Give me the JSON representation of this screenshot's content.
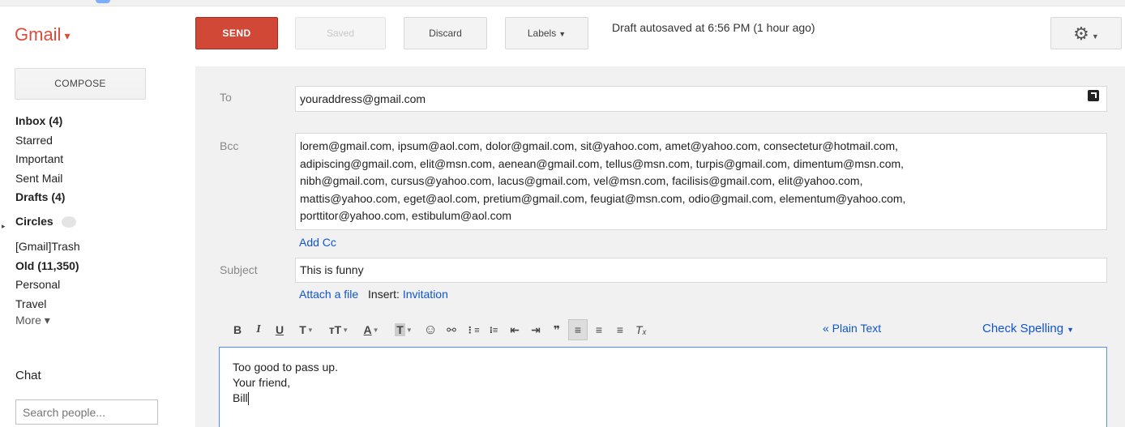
{
  "app": {
    "logo": "Gmail",
    "logo_caret": "▾"
  },
  "compose_button": "COMPOSE",
  "nav": {
    "inbox": "Inbox (4)",
    "starred": "Starred",
    "important": "Important",
    "sent": "Sent Mail",
    "drafts": "Drafts (4)",
    "circles": "Circles",
    "trash": "[Gmail]Trash",
    "old": "Old (11,350)",
    "personal": "Personal",
    "travel": "Travel",
    "more": "More ▾"
  },
  "chat": {
    "title": "Chat",
    "search_placeholder": "Search people..."
  },
  "toolbar": {
    "send": "SEND",
    "saved": "Saved",
    "discard": "Discard",
    "labels": "Labels",
    "autosave": "Draft autosaved at 6:56 PM (1 hour ago)",
    "settings_icon": "gear-icon"
  },
  "compose": {
    "to_label": "To",
    "to_value": "youraddress@gmail.com",
    "bcc_label": "Bcc",
    "bcc_lines": [
      "lorem@gmail.com, ipsum@aol.com, dolor@gmail.com, sit@yahoo.com, amet@yahoo.com, consectetur@hotmail.com,",
      "adipiscing@gmail.com, elit@msn.com, aenean@gmail.com, tellus@msn.com, turpis@gmail.com, dimentum@msn.com,",
      "nibh@gmail.com, cursus@yahoo.com, lacus@gmail.com, vel@msn.com, facilisis@gmail.com, elit@yahoo.com,",
      "mattis@yahoo.com, eget@aol.com, pretium@gmail.com, feugiat@msn.com, odio@gmail.com, elementum@yahoo.com,",
      "porttitor@yahoo.com, estibulum@aol.com"
    ],
    "add_cc": "Add Cc",
    "subject_label": "Subject",
    "subject_value": "This is funny",
    "attach": "Attach a file",
    "insert_label": "Insert:",
    "invitation": "Invitation",
    "plain_text": "« Plain Text",
    "check_spelling": "Check Spelling",
    "body_lines": [
      "Too good to pass up.",
      "Your friend,",
      "Bill"
    ]
  },
  "format_buttons": {
    "bold": "B",
    "italic": "I",
    "underline": "U",
    "font": "T",
    "size": "тT",
    "text_color": "A",
    "highlight": "T",
    "emoji": "☺",
    "link": "⚯",
    "numbered": "⋮≡",
    "bulleted": "⁝≡",
    "outdent": "⇤",
    "indent": "⇥",
    "quote": "❞",
    "align_left": "≡",
    "align_center": "≡",
    "align_right": "≡",
    "clear": "Tₓ"
  },
  "colors": {
    "send": "#d14836",
    "brand": "#dd4b39",
    "link": "#1155cc",
    "focus": "#4d90fe"
  }
}
